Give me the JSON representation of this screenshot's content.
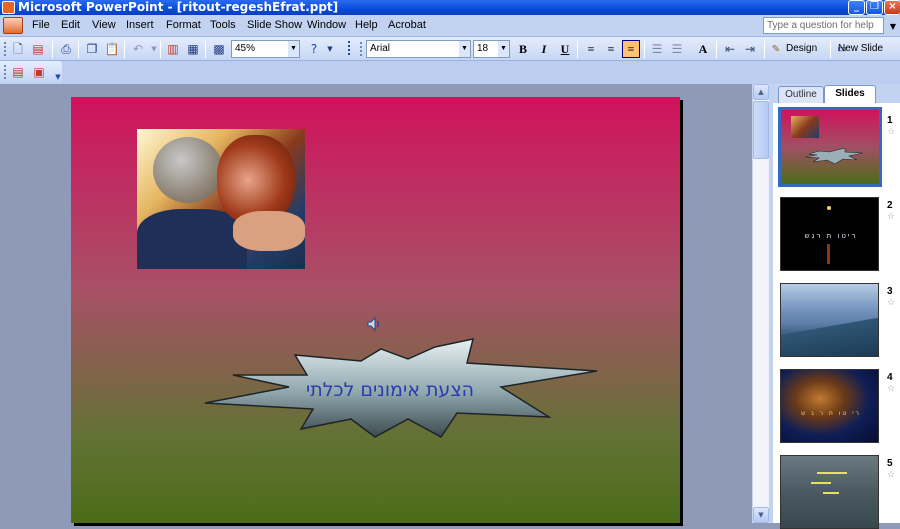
{
  "window": {
    "title": "Microsoft PowerPoint - [ritout-regeshEfrat.ppt]",
    "help_placeholder": "Type a question for help"
  },
  "menu": {
    "items": [
      "File",
      "Edit",
      "View",
      "Insert",
      "Format",
      "Tools",
      "Slide Show",
      "Window",
      "Help",
      "Acrobat"
    ]
  },
  "toolbar": {
    "zoom": "45%",
    "font": "Arial",
    "font_size": "18",
    "bold": "B",
    "italic": "I",
    "underline": "U",
    "font_grow": "A",
    "design_label": "Design",
    "new_slide_label": "New Slide"
  },
  "slide": {
    "burst_text": "הצעת אימונים לכלתי",
    "colors": {
      "top": "#d0125d",
      "bottom": "#4c6c18",
      "text": "#2b3ab0"
    }
  },
  "sidepane": {
    "tabs": [
      "Outline",
      "Slides"
    ],
    "active_tab": "Slides",
    "thumbnails": [
      {
        "number": "1",
        "text": ""
      },
      {
        "number": "2",
        "text": "ריטו ת רגש"
      },
      {
        "number": "3",
        "text": ""
      },
      {
        "number": "4",
        "text": "רי טו ת ר ג ש"
      },
      {
        "number": "5",
        "text": ""
      }
    ],
    "selected": "1"
  }
}
